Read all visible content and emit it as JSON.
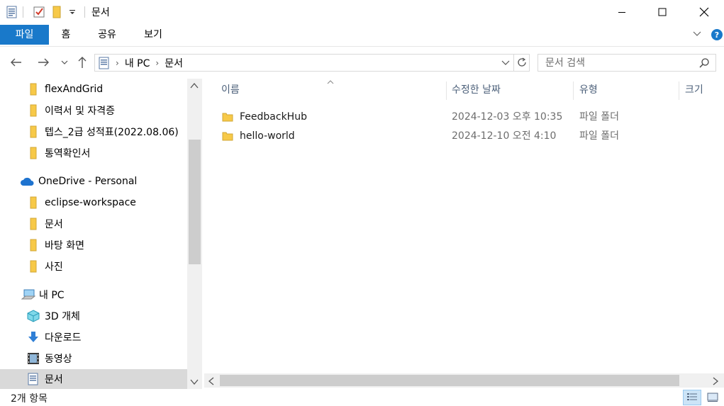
{
  "window": {
    "title": "문서"
  },
  "ribbon": {
    "tabs": [
      "파일",
      "홈",
      "공유",
      "보기"
    ]
  },
  "address": {
    "crumbs": [
      "내 PC",
      "문서"
    ]
  },
  "search": {
    "placeholder": "문서 검색"
  },
  "sidebar": {
    "items": [
      {
        "label": "flexAndGrid",
        "icon": "folder-icon"
      },
      {
        "label": "이력서 및 자격증",
        "icon": "folder-icon"
      },
      {
        "label": "텝스_2급 성적표(2022.08.06)",
        "icon": "folder-icon"
      },
      {
        "label": "통역확인서",
        "icon": "folder-icon"
      },
      {
        "label": "OneDrive - Personal",
        "icon": "onedrive-icon"
      },
      {
        "label": "eclipse-workspace",
        "icon": "folder-icon"
      },
      {
        "label": "문서",
        "icon": "folder-icon"
      },
      {
        "label": "바탕 화면",
        "icon": "folder-icon"
      },
      {
        "label": "사진",
        "icon": "folder-icon"
      },
      {
        "label": "내 PC",
        "icon": "pc-icon"
      },
      {
        "label": "3D 개체",
        "icon": "3d-objects-icon"
      },
      {
        "label": "다운로드",
        "icon": "download-icon"
      },
      {
        "label": "동영상",
        "icon": "video-icon"
      },
      {
        "label": "문서",
        "icon": "document-icon"
      }
    ]
  },
  "table": {
    "columns": [
      "이름",
      "수정한 날짜",
      "유형",
      "크기"
    ],
    "rows": [
      {
        "name": "FeedbackHub",
        "modified": "2024-12-03 오후 10:35",
        "type": "파일 폴더"
      },
      {
        "name": "hello-world",
        "modified": "2024-12-10 오전 4:10",
        "type": "파일 폴더"
      }
    ]
  },
  "status": {
    "count": "2개 항목"
  },
  "colors": {
    "file_tab": "#1979ca",
    "folder": "#f7c948",
    "selected": "#d9d9d9"
  }
}
